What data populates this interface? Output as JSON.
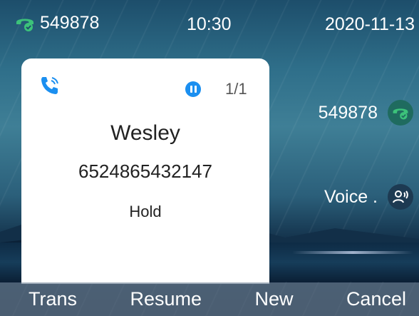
{
  "status_bar": {
    "line_number": "549878",
    "time": "10:30",
    "date": "2020-11-13"
  },
  "call_card": {
    "page": "1/1",
    "contact_name": "Wesley",
    "contact_number": "6524865432147",
    "call_state": "Hold"
  },
  "side_panel": {
    "line_label": "549878",
    "voice_label": "Voice ."
  },
  "softkeys": {
    "trans": "Trans",
    "resume": "Resume",
    "new": "New",
    "cancel": "Cancel"
  },
  "icons": {
    "status_line": "phone-handset-icon",
    "call": "incoming-call-icon",
    "hold": "pause-icon",
    "line_badge": "phone-handset-icon",
    "voice_badge": "voice-person-icon"
  },
  "colors": {
    "line_icon_green": "#3cc27a",
    "hold_blue": "#1b8ff0",
    "call_icon_blue": "#1b8ff0"
  }
}
